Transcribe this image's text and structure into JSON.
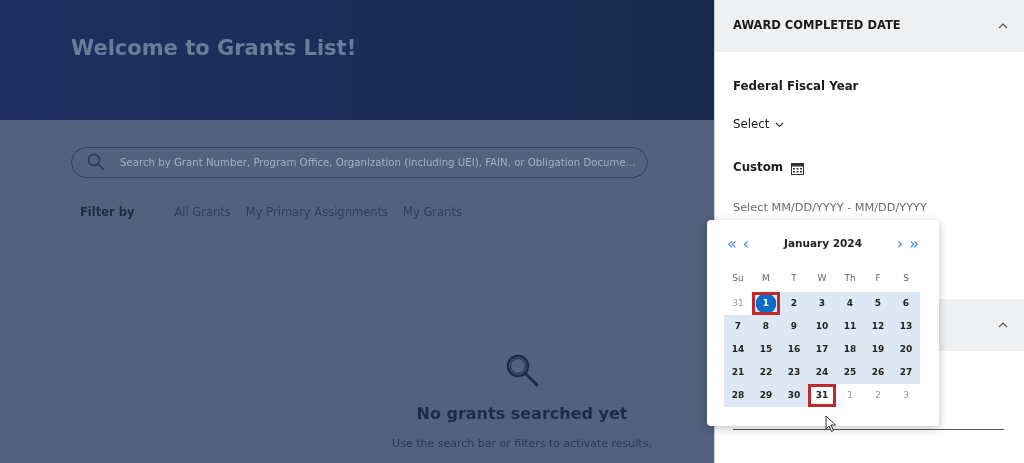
{
  "page": {
    "title": "Welcome to Grants List!",
    "search": {
      "placeholder": "Search by Grant Number, Program Office, Organization (including UEI), FAIN, or Obligation Docume..."
    },
    "filter": {
      "label": "Filter by",
      "options": [
        {
          "label": "All Grants",
          "selected": false
        },
        {
          "label": "My Primary Assignments",
          "selected": false
        },
        {
          "label": "My Grants",
          "selected": false
        }
      ]
    },
    "empty_state": {
      "title": "No grants searched yet",
      "message": "Use the search bar or filters to activate results."
    }
  },
  "filter_panel": {
    "sections": [
      {
        "title": "AWARD COMPLETED DATE",
        "expanded": true
      },
      {
        "expanded": true
      }
    ],
    "fiscal_year": {
      "label": "Federal Fiscal Year",
      "value": "Select"
    },
    "custom": {
      "label": "Custom",
      "placeholder": "Select MM/DD/YYYY - MM/DD/YYYY"
    }
  },
  "date_picker": {
    "month": "January 2024",
    "prev_year": "«",
    "prev_month": "‹",
    "next_month": "›",
    "next_year": "»",
    "weekdays": [
      "Su",
      "M",
      "T",
      "W",
      "Th",
      "F",
      "S"
    ],
    "weeks": [
      [
        {
          "day": "31",
          "muted": true,
          "in_range": false,
          "selected": false,
          "outlined": false
        },
        {
          "day": "1",
          "muted": false,
          "in_range": true,
          "selected": true,
          "outlined": true
        },
        {
          "day": "2",
          "muted": false,
          "in_range": true,
          "selected": false,
          "outlined": false
        },
        {
          "day": "3",
          "muted": false,
          "in_range": true,
          "selected": false,
          "outlined": false
        },
        {
          "day": "4",
          "muted": false,
          "in_range": true,
          "selected": false,
          "outlined": false
        },
        {
          "day": "5",
          "muted": false,
          "in_range": true,
          "selected": false,
          "outlined": false
        },
        {
          "day": "6",
          "muted": false,
          "in_range": true,
          "selected": false,
          "outlined": false
        }
      ],
      [
        {
          "day": "7",
          "muted": false,
          "in_range": true,
          "selected": false,
          "outlined": false
        },
        {
          "day": "8",
          "muted": false,
          "in_range": true,
          "selected": false,
          "outlined": false
        },
        {
          "day": "9",
          "muted": false,
          "in_range": true,
          "selected": false,
          "outlined": false
        },
        {
          "day": "10",
          "muted": false,
          "in_range": true,
          "selected": false,
          "outlined": false
        },
        {
          "day": "11",
          "muted": false,
          "in_range": true,
          "selected": false,
          "outlined": false
        },
        {
          "day": "12",
          "muted": false,
          "in_range": true,
          "selected": false,
          "outlined": false
        },
        {
          "day": "13",
          "muted": false,
          "in_range": true,
          "selected": false,
          "outlined": false
        }
      ],
      [
        {
          "day": "14",
          "muted": false,
          "in_range": true,
          "selected": false,
          "outlined": false
        },
        {
          "day": "15",
          "muted": false,
          "in_range": true,
          "selected": false,
          "outlined": false
        },
        {
          "day": "16",
          "muted": false,
          "in_range": true,
          "selected": false,
          "outlined": false
        },
        {
          "day": "17",
          "muted": false,
          "in_range": true,
          "selected": false,
          "outlined": false
        },
        {
          "day": "18",
          "muted": false,
          "in_range": true,
          "selected": false,
          "outlined": false
        },
        {
          "day": "19",
          "muted": false,
          "in_range": true,
          "selected": false,
          "outlined": false
        },
        {
          "day": "20",
          "muted": false,
          "in_range": true,
          "selected": false,
          "outlined": false
        }
      ],
      [
        {
          "day": "21",
          "muted": false,
          "in_range": true,
          "selected": false,
          "outlined": false
        },
        {
          "day": "22",
          "muted": false,
          "in_range": true,
          "selected": false,
          "outlined": false
        },
        {
          "day": "23",
          "muted": false,
          "in_range": true,
          "selected": false,
          "outlined": false
        },
        {
          "day": "24",
          "muted": false,
          "in_range": true,
          "selected": false,
          "outlined": false
        },
        {
          "day": "25",
          "muted": false,
          "in_range": true,
          "selected": false,
          "outlined": false
        },
        {
          "day": "26",
          "muted": false,
          "in_range": true,
          "selected": false,
          "outlined": false
        },
        {
          "day": "27",
          "muted": false,
          "in_range": true,
          "selected": false,
          "outlined": false
        }
      ],
      [
        {
          "day": "28",
          "muted": false,
          "in_range": true,
          "selected": false,
          "outlined": false
        },
        {
          "day": "29",
          "muted": false,
          "in_range": true,
          "selected": false,
          "outlined": false
        },
        {
          "day": "30",
          "muted": false,
          "in_range": true,
          "selected": false,
          "outlined": false
        },
        {
          "day": "31",
          "muted": false,
          "in_range": false,
          "selected": false,
          "outlined": true
        },
        {
          "day": "1",
          "muted": true,
          "in_range": false,
          "selected": false,
          "outlined": false
        },
        {
          "day": "2",
          "muted": true,
          "in_range": false,
          "selected": false,
          "outlined": false
        },
        {
          "day": "3",
          "muted": true,
          "in_range": false,
          "selected": false,
          "outlined": false
        }
      ]
    ]
  }
}
